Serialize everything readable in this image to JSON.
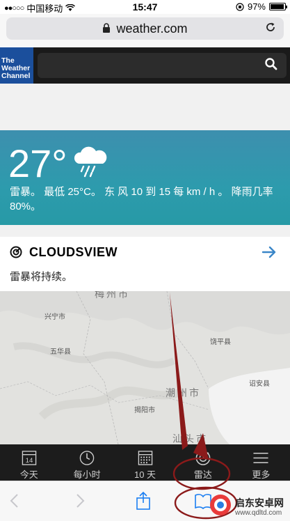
{
  "status_bar": {
    "carrier": "中国移动",
    "time": "15:47",
    "battery": "97%",
    "battery_level": 0.97
  },
  "address_bar": {
    "domain": "weather.com"
  },
  "site_header": {
    "logo_lines": [
      "The",
      "Weather",
      "Channel"
    ]
  },
  "current_weather": {
    "temperature": "27°",
    "description": "雷暴。 最低 25°C。 东 风 10 到 15 每 km / h 。 降雨几率 80%。",
    "icon": "thunderstorm-rain-icon"
  },
  "cloudsview": {
    "title": "CLOUDSVIEW",
    "subtitle": "雷暴将持续。"
  },
  "map": {
    "cities": [
      "梅州市",
      "兴宁市",
      "五华县",
      "潮州市",
      "揭阳市",
      "汕头市",
      "饶平县",
      "诏安县"
    ]
  },
  "site_nav": {
    "items": [
      {
        "label": "今天",
        "icon": "calendar-day-icon",
        "badge": "14"
      },
      {
        "label": "每小时",
        "icon": "clock-icon"
      },
      {
        "label": "10 天",
        "icon": "calendar-grid-icon"
      },
      {
        "label": "雷达",
        "icon": "radar-icon"
      },
      {
        "label": "更多",
        "icon": "menu-icon"
      }
    ]
  },
  "watermark": {
    "name": "启东安卓网",
    "url": "www.qdltd.com"
  },
  "colors": {
    "weather_card": "#2d9bad",
    "annotation": "#8b1a1a",
    "logo_blue": "#1b4f9c",
    "arrow_blue": "#3a86c8"
  }
}
